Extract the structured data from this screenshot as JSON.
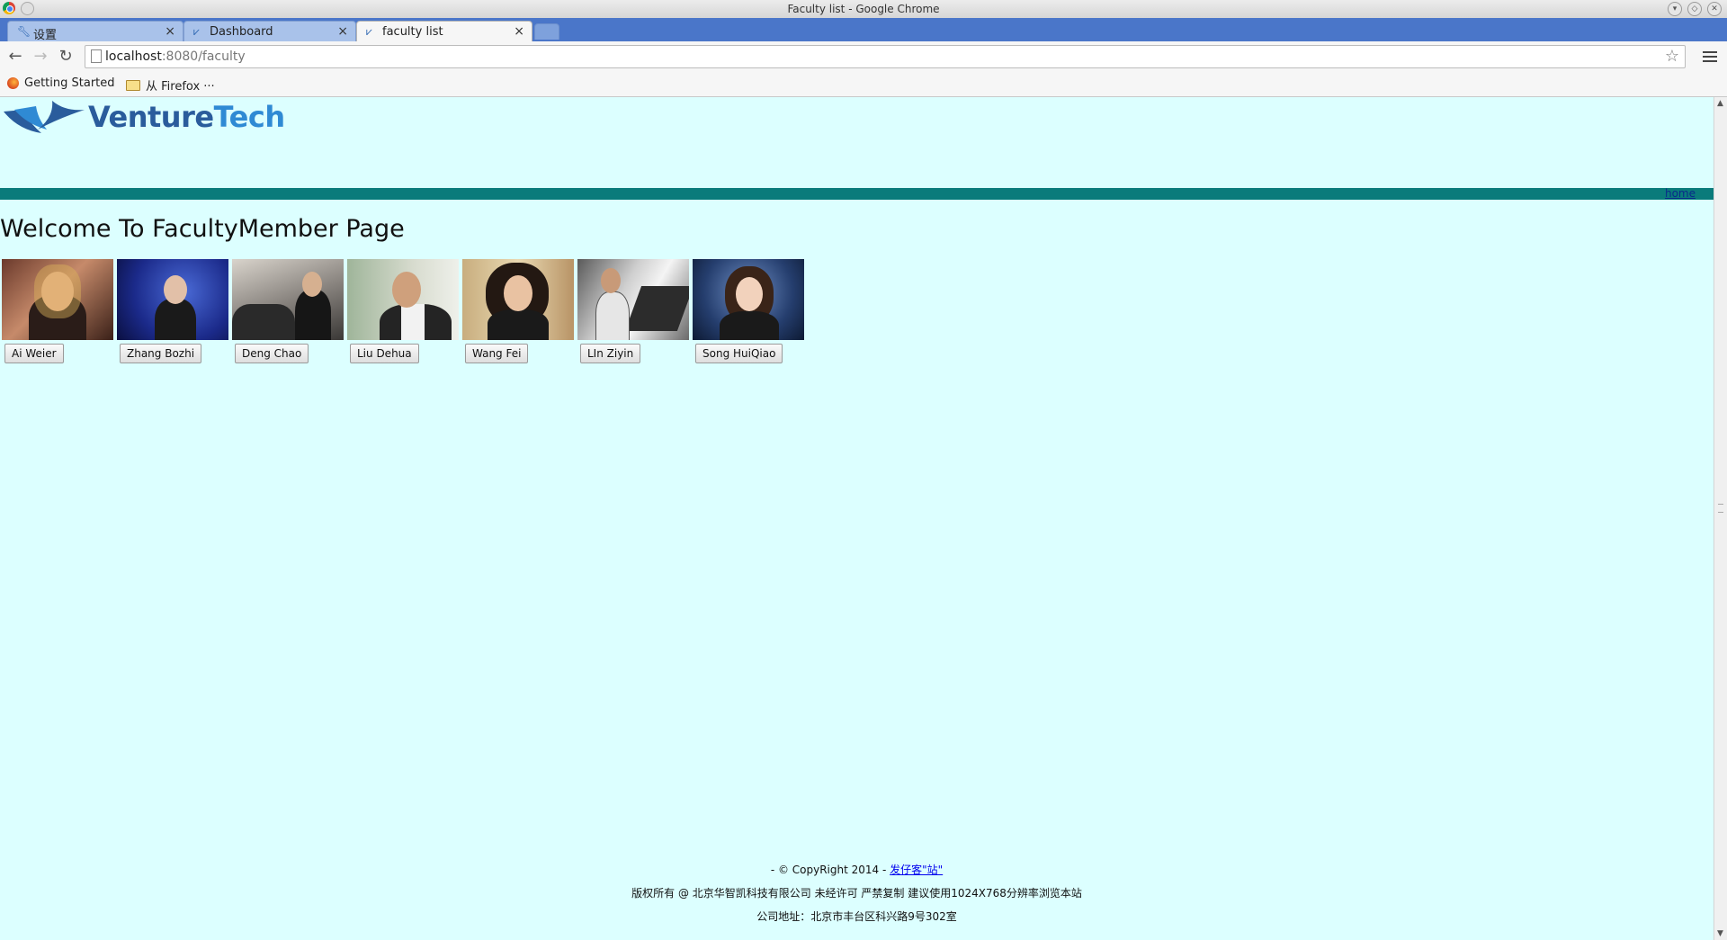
{
  "window": {
    "title": "Faculty list - Google Chrome"
  },
  "tabs": [
    {
      "label": "设置",
      "icon": "wrench-icon"
    },
    {
      "label": "Dashboard",
      "icon": "venturetech-favicon"
    },
    {
      "label": "faculty list",
      "icon": "venturetech-favicon",
      "active": true
    }
  ],
  "toolbar": {
    "url_host": "localhost",
    "url_rest": ":8080/faculty"
  },
  "bookmarks": [
    {
      "label": "Getting Started",
      "icon": "firefox-icon"
    },
    {
      "label": "从 Firefox ···",
      "icon": "folder-icon"
    }
  ],
  "logo": {
    "part1": "Venture",
    "part2": "Tech"
  },
  "nav": {
    "home": "home"
  },
  "page": {
    "heading": "Welcome To FacultyMember Page"
  },
  "faculty": [
    {
      "name": "Ai Weier"
    },
    {
      "name": "Zhang Bozhi"
    },
    {
      "name": "Deng Chao"
    },
    {
      "name": "Liu Dehua"
    },
    {
      "name": "Wang Fei"
    },
    {
      "name": "LIn Ziyin"
    },
    {
      "name": "Song HuiQiao"
    }
  ],
  "footer": {
    "copyright_prefix": "- © CopyRight 2014 -",
    "copyright_link": "发仔客\"站\"",
    "rights": "版权所有 @ 北京华智凯科技有限公司 未经许可 严禁复制 建议使用1024X768分辨率浏览本站",
    "address": "公司地址：北京市丰台区科兴路9号302室"
  },
  "colors": {
    "page_background": "#dcffff",
    "nav_band": "#0a7b7b",
    "tabstrip": "#4a76c9"
  }
}
